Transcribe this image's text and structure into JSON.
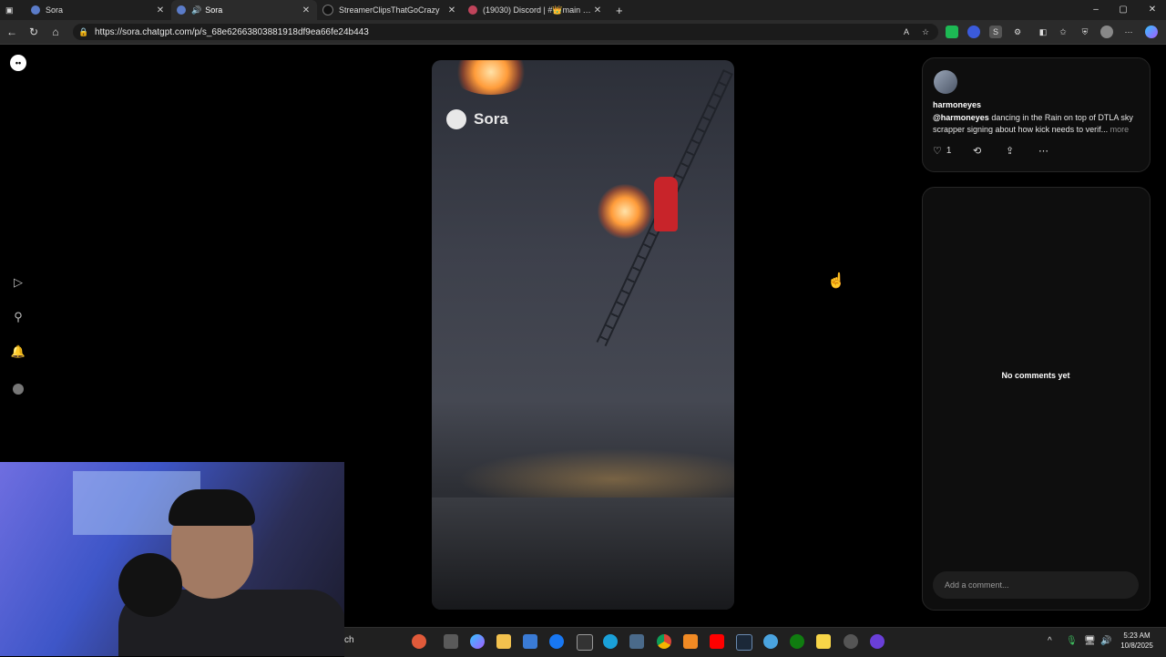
{
  "browser": {
    "tabs": [
      {
        "title": "Sora",
        "active": false
      },
      {
        "title": "Sora",
        "active": true
      },
      {
        "title": "StreamerClipsThatGoCrazy",
        "active": false
      },
      {
        "title": "(19030) Discord | #👑main | EB I",
        "active": false
      }
    ],
    "new_tab_label": "+",
    "window_controls": {
      "minimize": "–",
      "maximize": "▢",
      "close": "✕"
    },
    "url": "https://sora.chatgpt.com/p/s_68e62663803881918df9ea66fe24b443"
  },
  "sora": {
    "watermark_text": "Sora",
    "post": {
      "username": "harmoneyes",
      "handle": "@harmoneyes",
      "caption": "dancing in the Rain on top of DTLA sky scrapper signing about how kick needs to verif...",
      "more_label": "more",
      "like_count": "1"
    },
    "comments": {
      "empty_text": "No comments yet",
      "input_placeholder": "Add a comment..."
    }
  },
  "taskbar": {
    "search_fragment": "ch",
    "time": "5:23 AM",
    "date": "10/8/2025"
  },
  "colors": {
    "page_bg": "#000000",
    "panel_bg": "#0e0e0e",
    "accent_red": "#c8242a"
  }
}
